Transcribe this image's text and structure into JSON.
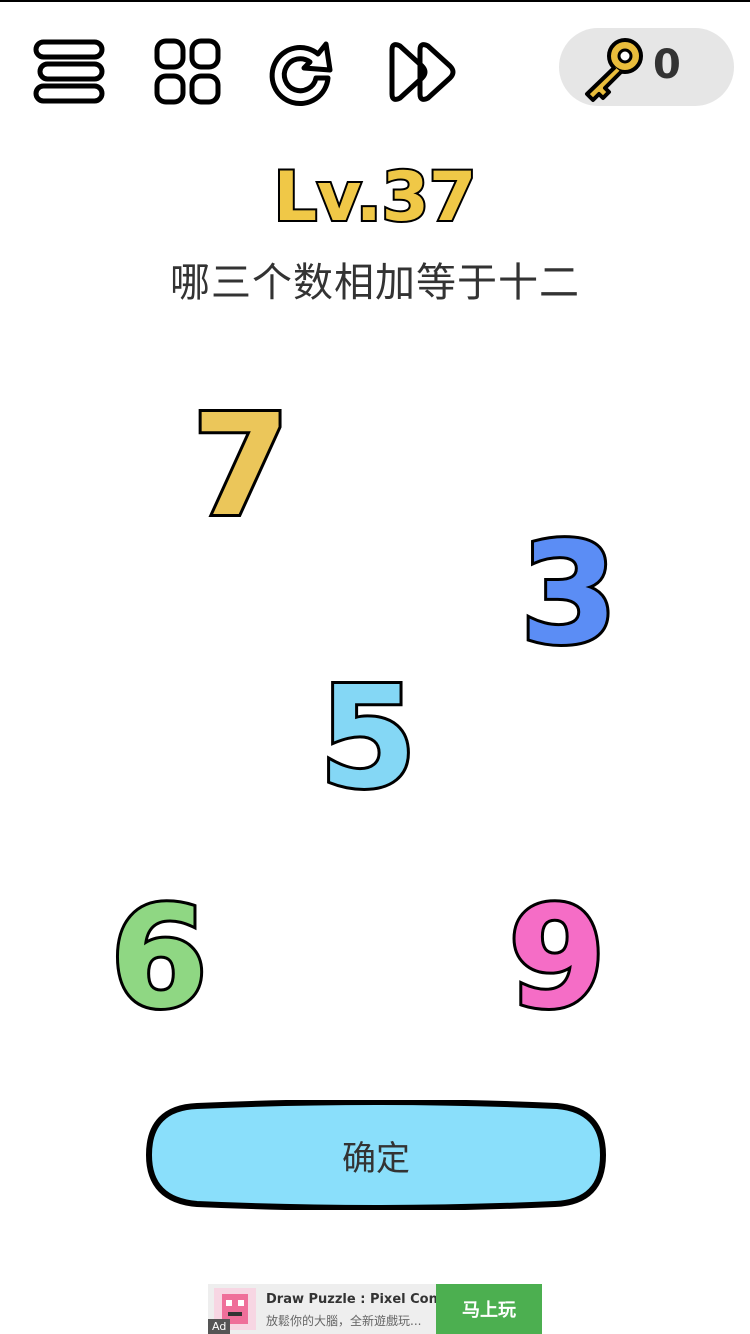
{
  "toolbar": {
    "icons": [
      "menu-icon",
      "grid-icon",
      "restart-icon",
      "skip-icon"
    ],
    "key_icon": "key-icon",
    "key_count": "0"
  },
  "level": {
    "label": "Lv.37",
    "color": "#f0c847"
  },
  "question": "哪三个数相加等于十二",
  "numbers": [
    {
      "value": "7",
      "color": "#ebc65a"
    },
    {
      "value": "3",
      "color": "#5b8df5"
    },
    {
      "value": "5",
      "color": "#84d7f5"
    },
    {
      "value": "6",
      "color": "#8fd783"
    },
    {
      "value": "9",
      "color": "#f56dc6"
    }
  ],
  "confirm_button": {
    "label": "确定",
    "color": "#8adffb"
  },
  "ad": {
    "badge": "Ad",
    "title": "Draw Puzzle : Pixel Connec...",
    "subtitle": "放鬆你的大腦，全新遊戲玩...",
    "cta": "马上玩",
    "cta_color": "#4caf50"
  }
}
